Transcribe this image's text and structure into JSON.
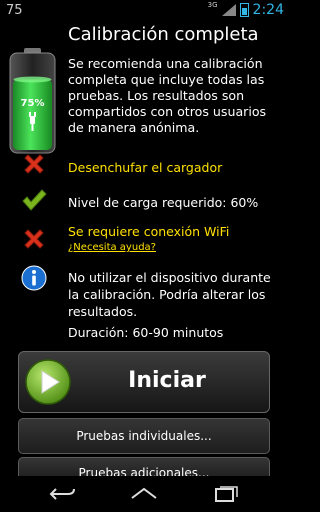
{
  "status_bar": {
    "left_text": "75",
    "network": "3G",
    "time": "2:24"
  },
  "battery": {
    "percent_label": "75%",
    "level": 0.75,
    "fill_color": "#2cc43a"
  },
  "title": "Calibración completa",
  "description": "Se recomienda una calibración completa que incluye todas las pruebas. Los resultados son compartidos con otros usuarios de manera anónima.",
  "requirements": [
    {
      "status": "fail",
      "icon": "red-x-icon",
      "text": "Desenchufar el cargador",
      "color": "#ffe000"
    },
    {
      "status": "ok",
      "icon": "green-check-icon",
      "text": "Nivel de carga requerido: 60%",
      "color": "#ffffff"
    },
    {
      "status": "fail",
      "icon": "red-x-icon",
      "text": "Se requiere conexión WiFi",
      "color": "#ffe000",
      "help_link": "¿Necesita ayuda?"
    },
    {
      "status": "info",
      "icon": "info-icon",
      "text": "No utilizar el dispositivo durante la calibración. Podría alterar los resultados."
    }
  ],
  "duration": "Duración: 60-90 minutos",
  "buttons": {
    "start": "Iniciar",
    "individual": "Pruebas individuales...",
    "additional": "Pruebas adicionales..."
  },
  "colors": {
    "accent": "#33b5e5",
    "warning": "#ffe000",
    "fail": "#d9311b",
    "ok": "#7ab51d",
    "info": "#1a6fd1"
  }
}
